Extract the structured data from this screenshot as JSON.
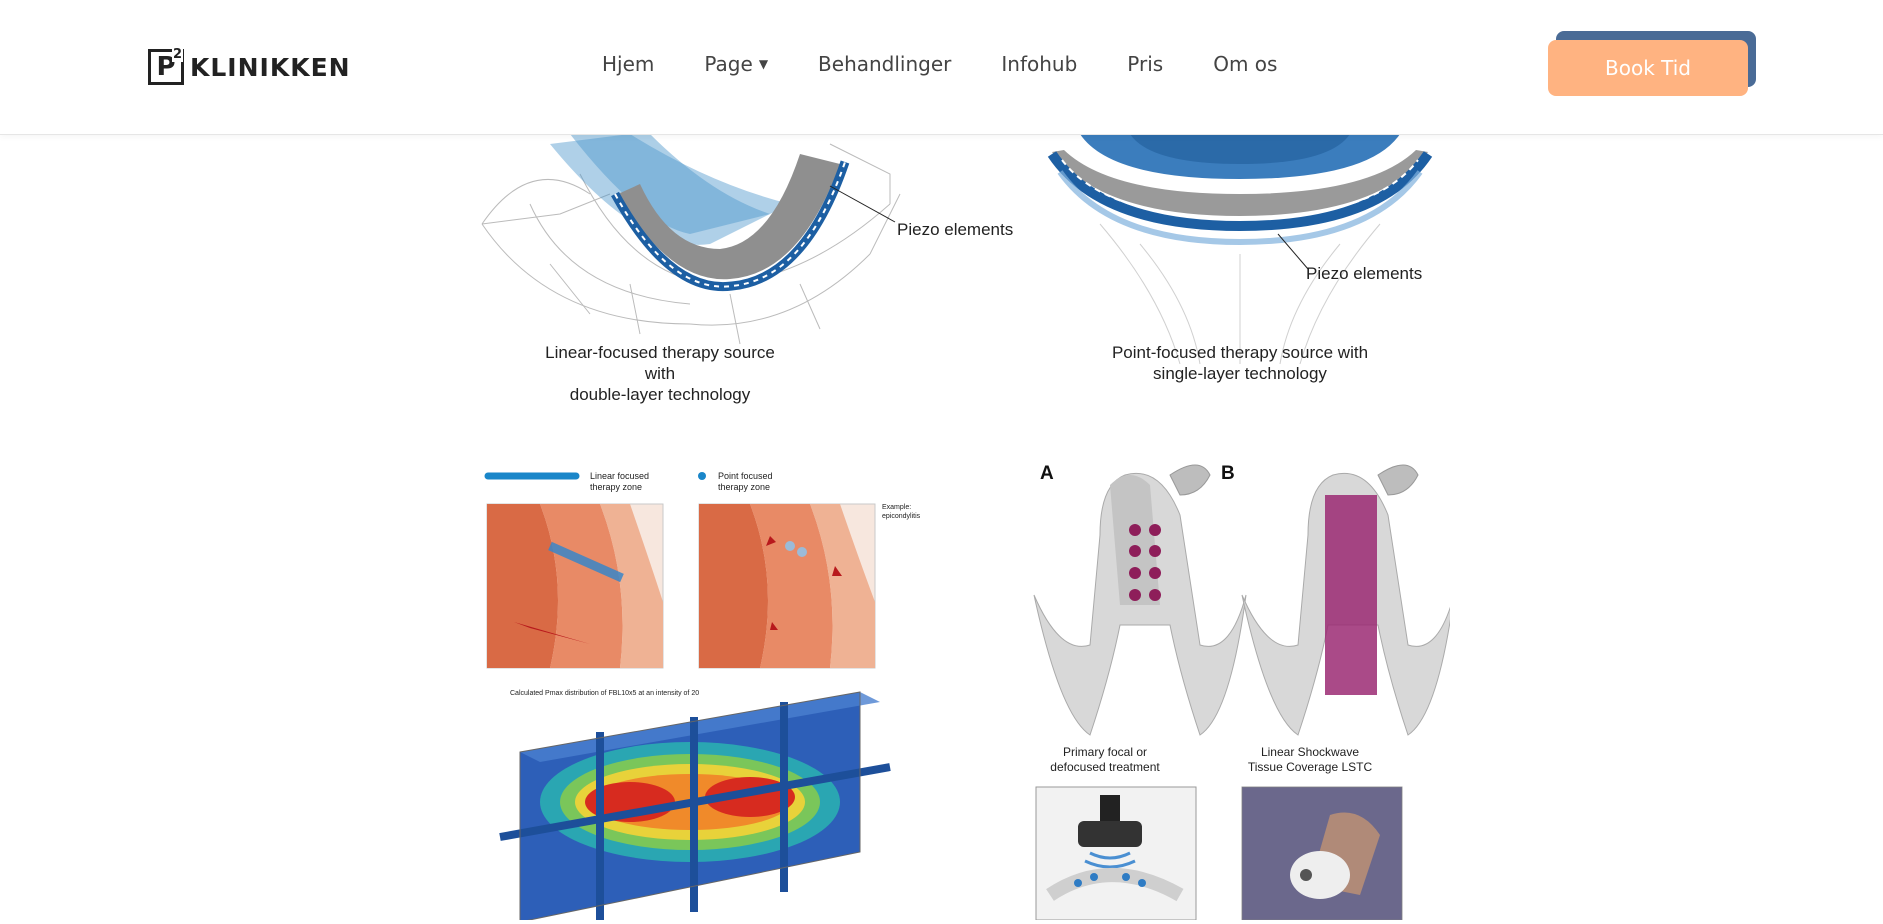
{
  "brand": {
    "mark": "P",
    "superscript": "2",
    "name": "KLINIKKEN"
  },
  "nav": {
    "items": [
      {
        "label": "Hjem"
      },
      {
        "label": "Page"
      },
      {
        "label": "Behandlinger"
      },
      {
        "label": "Infohub"
      },
      {
        "label": "Pris"
      },
      {
        "label": "Om os"
      }
    ]
  },
  "cta": {
    "label": "Book Tid"
  },
  "figure_linear": {
    "callout": "Piezo elements",
    "caption_line1": "Linear-focused therapy source with",
    "caption_line2": "double-layer technology"
  },
  "figure_point": {
    "callout": "Piezo elements",
    "caption_line1": "Point-focused therapy source with",
    "caption_line2": "single-layer technology"
  },
  "figure_zones": {
    "legend_linear": "Linear focused therapy zone",
    "legend_linear_l1": "Linear focused",
    "legend_linear_l2": "therapy zone",
    "legend_point_l1": "Point focused",
    "legend_point_l2": "therapy zone",
    "example_l1": "Example:",
    "example_l2": "epicondylitis",
    "heatmap_title": "Calculated Pmax distribution of FBL10x5 at an intensity of 20"
  },
  "figure_penile": {
    "panel_a": "A",
    "panel_b": "B",
    "caption_a_l1": "Primary focal or",
    "caption_a_l2": "defocused treatment",
    "caption_b_l1": "Linear Shockwave",
    "caption_b_l2": "Tissue Coverage LSTC"
  },
  "colors": {
    "accent": "#ffb381",
    "accent_shadow": "#4a6b96",
    "piezo_blue": "#1d5fa3",
    "dot_magenta": "#8e1e5a"
  }
}
